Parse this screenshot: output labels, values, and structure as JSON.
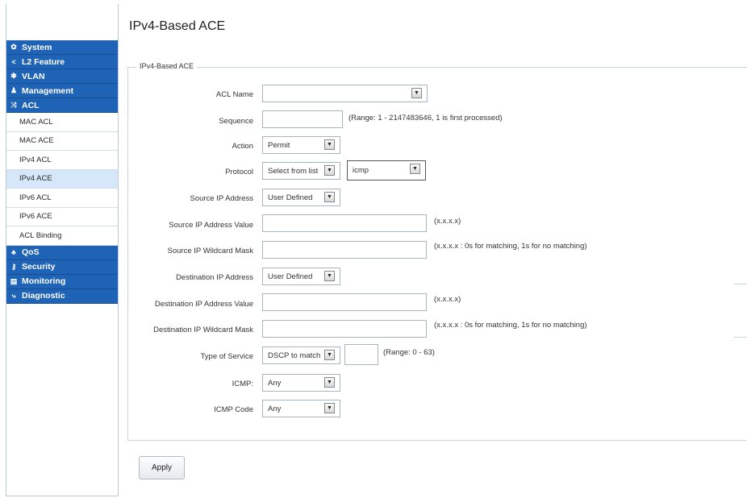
{
  "sidebar": {
    "sections_top": [
      {
        "label": "System",
        "icon": "gear-icon",
        "glyph": "✿"
      },
      {
        "label": "L2 Feature",
        "icon": "share-icon",
        "glyph": "<"
      },
      {
        "label": "VLAN",
        "icon": "network-icon",
        "glyph": "✱"
      },
      {
        "label": "Management",
        "icon": "user-icon",
        "glyph": "♟"
      },
      {
        "label": "ACL",
        "icon": "shuffle-icon",
        "glyph": "⤨"
      }
    ],
    "acl_items": [
      "MAC ACL",
      "MAC ACE",
      "IPv4 ACL",
      "IPv4 ACE",
      "IPv6 ACL",
      "IPv6 ACE",
      "ACL Binding"
    ],
    "active_item": "IPv4 ACE",
    "sections_bottom": [
      {
        "label": "QoS",
        "icon": "qos-icon",
        "glyph": "♣"
      },
      {
        "label": "Security",
        "icon": "key-icon",
        "glyph": "⚷"
      },
      {
        "label": "Monitoring",
        "icon": "monitor-icon",
        "glyph": "▤"
      },
      {
        "label": "Diagnostic",
        "icon": "wrench-icon",
        "glyph": "⤷"
      }
    ]
  },
  "page": {
    "title": "IPv4-Based ACE",
    "legend": "IPv4-Based ACE"
  },
  "form": {
    "acl_name": {
      "label": "ACL Name",
      "value": ""
    },
    "sequence": {
      "label": "Sequence",
      "value": "",
      "hint": "(Range: 1 - 2147483646, 1 is first processed)"
    },
    "action": {
      "label": "Action",
      "value": "Permit"
    },
    "protocol": {
      "label": "Protocol",
      "value": "Select from list",
      "value2": "icmp"
    },
    "src_ip": {
      "label": "Source IP Address",
      "value": "User Defined"
    },
    "src_ip_value": {
      "label": "Source IP Address Value",
      "value": "",
      "hint": "(x.x.x.x)"
    },
    "src_wildcard": {
      "label": "Source IP Wildcard Mask",
      "value": "",
      "hint": "(x.x.x.x : 0s for matching, 1s for no matching)"
    },
    "dst_ip": {
      "label": "Destination IP Address",
      "value": "User Defined"
    },
    "dst_ip_value": {
      "label": "Destination IP Address Value",
      "value": "",
      "hint": "(x.x.x.x)"
    },
    "dst_wildcard": {
      "label": "Destination IP Wildcard Mask",
      "value": "",
      "hint": "(x.x.x.x : 0s for matching, 1s for no matching)"
    },
    "tos": {
      "label": "Type of Service",
      "value": "DSCP to match",
      "value2": "",
      "hint": "(Range: 0 - 63)"
    },
    "icmp": {
      "label": "ICMP:",
      "value": "Any"
    },
    "icmp_code": {
      "label": "ICMP Code",
      "value": "Any"
    }
  },
  "buttons": {
    "apply": "Apply"
  }
}
